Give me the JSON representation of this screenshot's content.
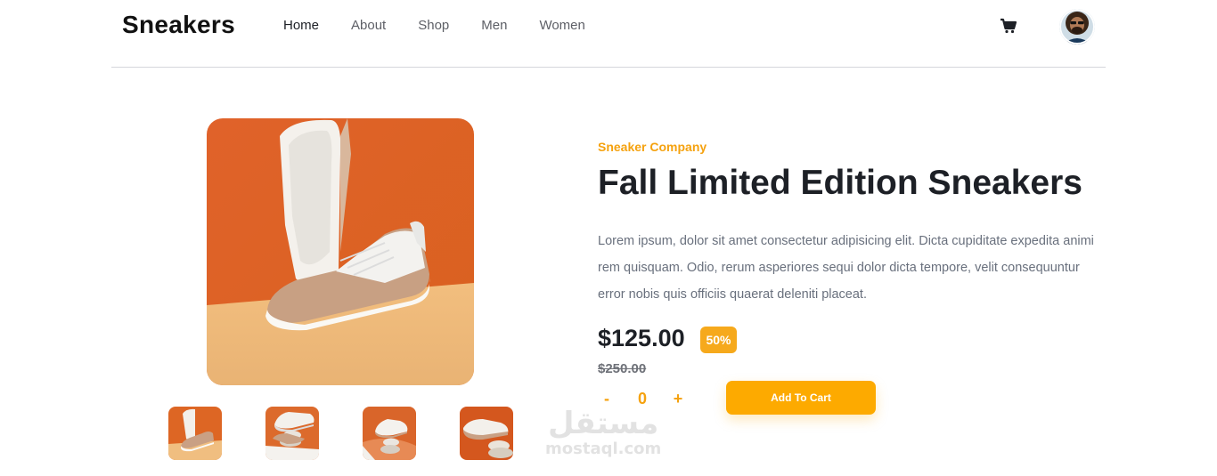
{
  "header": {
    "logo": "Sneakers",
    "nav": [
      {
        "label": "Home",
        "active": true
      },
      {
        "label": "About",
        "active": false
      },
      {
        "label": "Shop",
        "active": false
      },
      {
        "label": "Men",
        "active": false
      },
      {
        "label": "Women",
        "active": false
      }
    ],
    "cart_icon": "cart-icon",
    "avatar_icon": "avatar"
  },
  "product": {
    "company": "Sneaker Company",
    "title": "Fall Limited Edition Sneakers",
    "description": "Lorem ipsum, dolor sit amet consectetur adipisicing elit. Dicta cupiditate expedita animi rem quisquam. Odio, rerum asperiores sequi dolor dicta tempore, velit consequuntur error nobis quis officiis quaerat deleniti placeat.",
    "price": "$125.00",
    "discount": "50%",
    "old_price": "$250.00",
    "quantity": "0",
    "minus": "-",
    "plus": "+",
    "add_to_cart": "Add To Cart"
  },
  "watermark": {
    "arabic": "مستقل",
    "latin": "mostaql.com"
  },
  "colors": {
    "accent": "#fdaa00",
    "text_dark": "#1d2026",
    "text_muted": "#69707d"
  }
}
